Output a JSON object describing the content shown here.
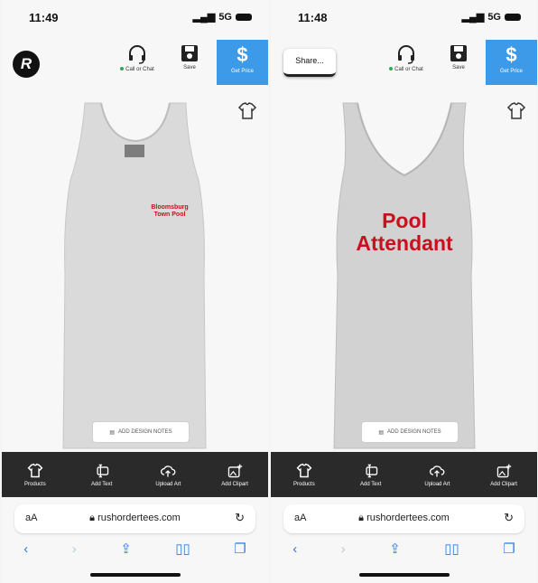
{
  "left_screen": {
    "time": "11:49",
    "signal": "5G",
    "call_label": "Call or Chat",
    "save_label": "Save",
    "price_label": "Get Price",
    "price_symbol": "$",
    "print_text": "Bloomsburg Town Pool",
    "notes_label": "ADD DESIGN NOTES",
    "url": "rushordertees.com"
  },
  "right_screen": {
    "time": "11:48",
    "signal": "5G",
    "share_label": "Share...",
    "call_label": "Call or Chat",
    "save_label": "Save",
    "price_label": "Get Price",
    "price_symbol": "$",
    "print_text_line1": "Pool",
    "print_text_line2": "Attendant",
    "notes_label": "ADD DESIGN NOTES",
    "url": "rushordertees.com"
  },
  "toolbar": {
    "products": "Products",
    "add_text": "Add Text",
    "upload_art": "Upload Art",
    "add_clipart": "Add Clipart"
  },
  "browser": {
    "text_size": "aA"
  },
  "colors": {
    "accent_blue": "#3d9ae8",
    "print_red": "#c8101e",
    "toolbar_bg": "#2a2a2a",
    "safari_blue": "#2f7be0"
  }
}
